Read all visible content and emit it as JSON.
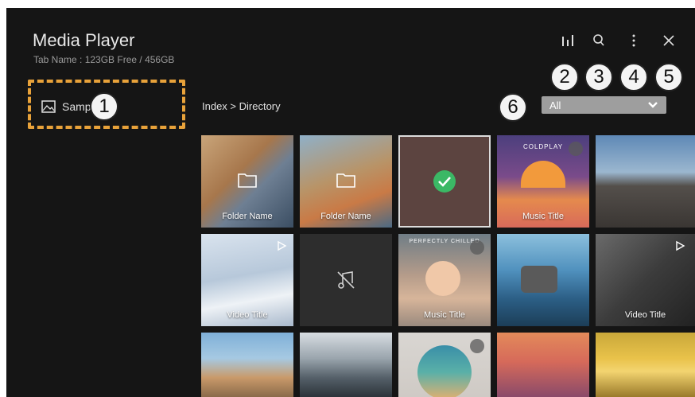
{
  "app": {
    "title": "Media Player",
    "storage": "Tab Name : 123GB Free / 456GB"
  },
  "sidebar": {
    "item_label": "Samp"
  },
  "breadcrumb": "Index > Directory",
  "filter": {
    "selected": "All"
  },
  "toolbar": {
    "icons": [
      "equalizer-icon",
      "search-icon",
      "more-icon",
      "close-icon"
    ]
  },
  "callouts": [
    "1",
    "2",
    "3",
    "4",
    "5",
    "6"
  ],
  "tiles": {
    "folder1": "Folder Name",
    "folder2": "Folder Name",
    "music1": "Music Title",
    "video1": "Video Title",
    "music2": "Music Title",
    "video2": "Video Title",
    "album_top": "COLDPLAY",
    "album2_top": "PERFECTLY CHILLED"
  },
  "colors": {
    "background": "#151515",
    "dashed_highlight": "#e8a23a",
    "selection_check": "#3bb865",
    "dropdown": "#9e9e9e"
  }
}
